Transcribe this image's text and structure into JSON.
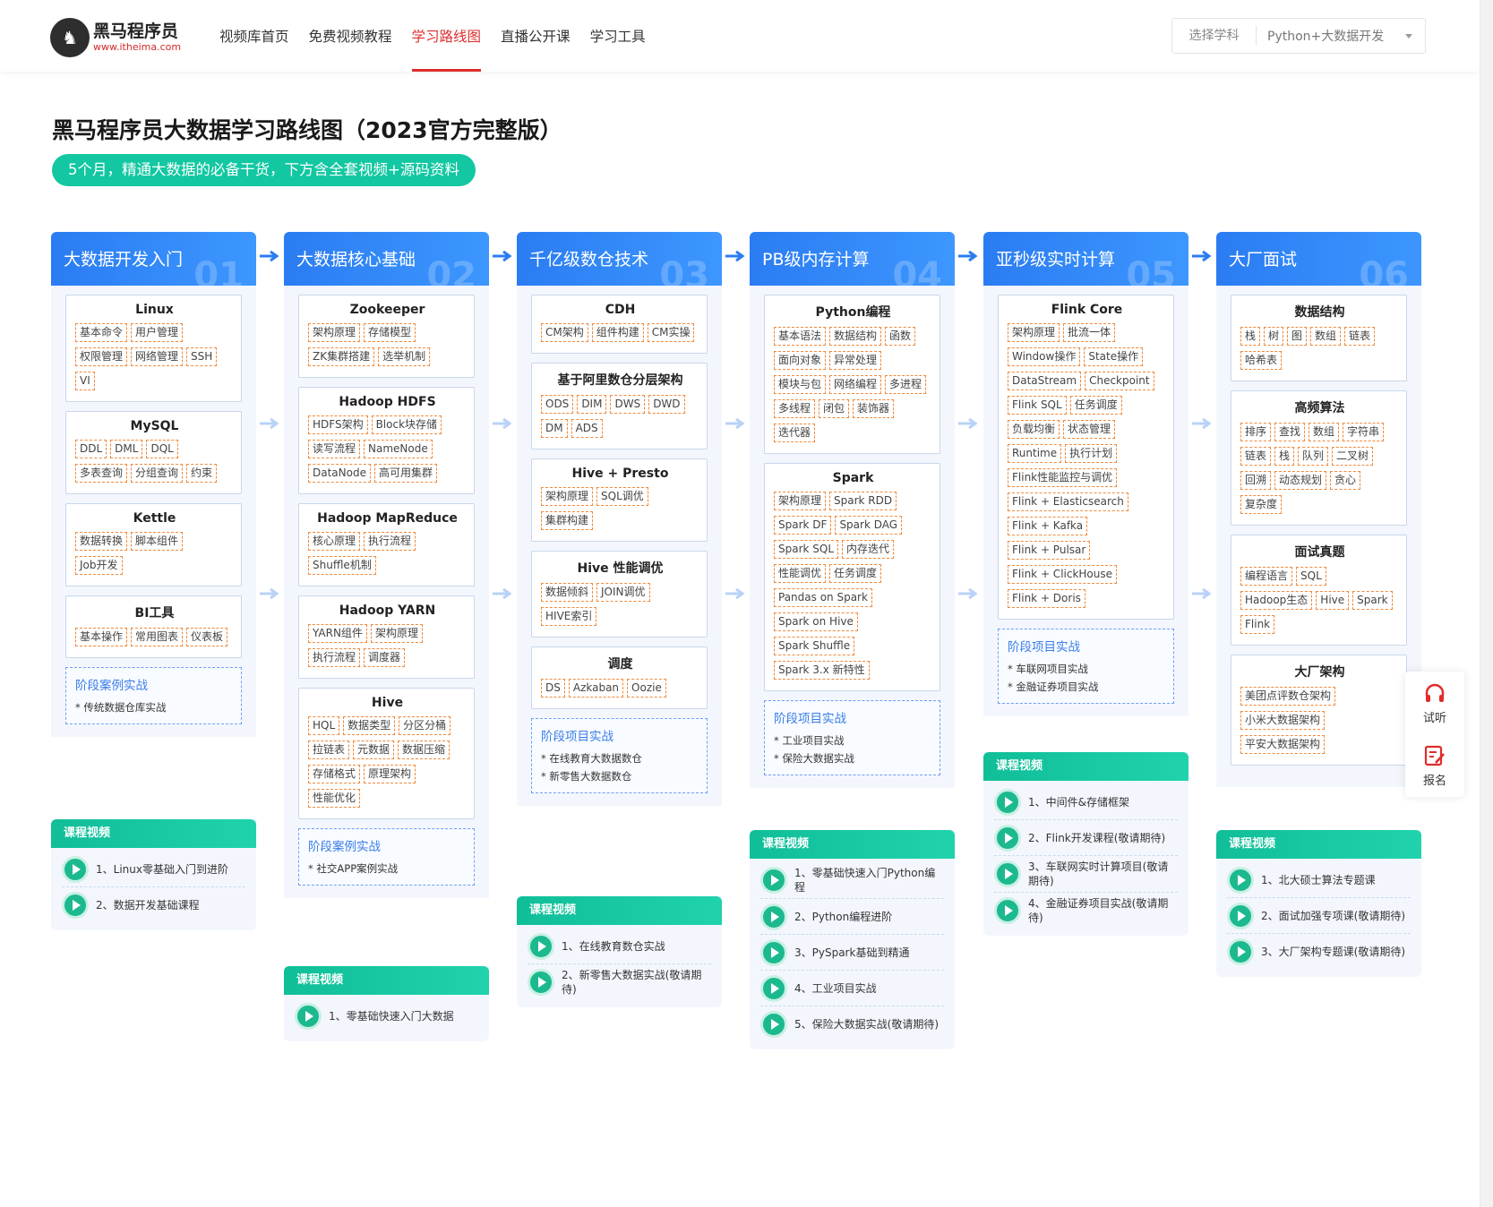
{
  "header": {
    "logo_name": "黑马程序员",
    "logo_url": "www.itheima.com",
    "nav": [
      "视频库首页",
      "免费视频教程",
      "学习路线图",
      "直播公开课",
      "学习工具"
    ],
    "active_nav": "学习路线图",
    "selector_label": "选择学科",
    "selector_value": "Python+大数据开发"
  },
  "page_title": "黑马程序员大数据学习路线图（2023官方完整版）",
  "subtitle": "5个月，精通大数据的必备干货，下方含全套视频+源码资料",
  "columns": [
    {
      "title": "大数据开发入门",
      "num": "01",
      "cards": [
        {
          "title": "Linux",
          "tags": [
            "基本命令",
            "用户管理",
            "权限管理",
            "网络管理",
            "SSH",
            "VI"
          ]
        },
        {
          "title": "MySQL",
          "tags": [
            "DDL",
            "DML",
            "DQL",
            "多表查询",
            "分组查询",
            "约束"
          ]
        },
        {
          "title": "Kettle",
          "tags": [
            "数据转换",
            "脚本组件",
            "Job开发"
          ]
        },
        {
          "title": "BI工具",
          "tags": [
            "基本操作",
            "常用图表",
            "仪表板"
          ]
        }
      ],
      "stage_title": "阶段案例实战",
      "stage_items": [
        "* 传统数据仓库实战"
      ],
      "video_head": "课程视频",
      "videos": [
        "1、Linux零基础入门到进阶",
        "2、数据开发基础课程"
      ]
    },
    {
      "title": "大数据核心基础",
      "num": "02",
      "cards": [
        {
          "title": "Zookeeper",
          "tags": [
            "架构原理",
            "存储模型",
            "ZK集群搭建",
            "选举机制"
          ]
        },
        {
          "title": "Hadoop HDFS",
          "tags": [
            "HDFS架构",
            "Block块存储",
            "读写流程",
            "NameNode",
            "DataNode",
            "高可用集群"
          ]
        },
        {
          "title": "Hadoop MapReduce",
          "tags": [
            "核心原理",
            "执行流程",
            "Shuffle机制"
          ]
        },
        {
          "title": "Hadoop YARN",
          "tags": [
            "YARN组件",
            "架构原理",
            "执行流程",
            "调度器"
          ]
        },
        {
          "title": "Hive",
          "tags": [
            "HQL",
            "数据类型",
            "分区分桶",
            "拉链表",
            "元数据",
            "数据压缩",
            "存储格式",
            "原理架构",
            "性能优化"
          ]
        }
      ],
      "stage_title": "阶段案例实战",
      "stage_items": [
        "* 社交APP案例实战"
      ],
      "video_head": "课程视频",
      "videos": [
        "1、零基础快速入门大数据"
      ]
    },
    {
      "title": "千亿级数仓技术",
      "num": "03",
      "cards": [
        {
          "title": "CDH",
          "tags": [
            "CM架构",
            "组件构建",
            "CM实操"
          ]
        },
        {
          "title": "基于阿里数仓分层架构",
          "tags": [
            "ODS",
            "DIM",
            "DWS",
            "DWD",
            "DM",
            "ADS"
          ]
        },
        {
          "title": "Hive + Presto",
          "tags": [
            "架构原理",
            "SQL调优",
            "集群构建"
          ]
        },
        {
          "title": "Hive 性能调优",
          "tags": [
            "数据倾斜",
            "JOIN调优",
            "HIVE索引"
          ]
        },
        {
          "title": "调度",
          "tags": [
            "DS",
            "Azkaban",
            "Oozie"
          ]
        }
      ],
      "stage_title": "阶段项目实战",
      "stage_items": [
        "* 在线教育大数据数仓",
        "* 新零售大数据数仓"
      ],
      "video_head": "课程视频",
      "videos": [
        "1、在线教育数仓实战",
        "2、新零售大数据实战(敬请期待)"
      ]
    },
    {
      "title": "PB级内存计算",
      "num": "04",
      "cards": [
        {
          "title": "Python编程",
          "tags": [
            "基本语法",
            "数据结构",
            "函数",
            "面向对象",
            "异常处理",
            "模块与包",
            "网络编程",
            "多进程",
            "多线程",
            "闭包",
            "装饰器",
            "迭代器"
          ]
        },
        {
          "title": "Spark",
          "tags": [
            "架构原理",
            "Spark RDD",
            "Spark DF",
            "Spark DAG",
            "Spark SQL",
            "内存迭代",
            "性能调优",
            "任务调度",
            "Pandas on Spark",
            "Spark on Hive",
            "Spark Shuffle",
            "Spark 3.x 新特性"
          ]
        }
      ],
      "stage_title": "阶段项目实战",
      "stage_items": [
        "* 工业项目实战",
        "* 保险大数据实战"
      ],
      "video_head": "课程视频",
      "videos": [
        "1、零基础快速入门Python编程",
        "2、Python编程进阶",
        "3、PySpark基础到精通",
        "4、工业项目实战",
        "5、保险大数据实战(敬请期待)"
      ]
    },
    {
      "title": "亚秒级实时计算",
      "num": "05",
      "cards": [
        {
          "title": "Flink Core",
          "tags": [
            "架构原理",
            "批流一体",
            "Window操作",
            "State操作",
            "DataStream",
            "Checkpoint",
            "Flink SQL",
            "任务调度",
            "负载均衡",
            "状态管理",
            "Runtime",
            "执行计划",
            "Flink性能监控与调优",
            "Flink + Elasticsearch",
            "Flink + Kafka",
            "Flink + Pulsar",
            "Flink + ClickHouse",
            "Flink + Doris"
          ]
        }
      ],
      "stage_title": "阶段项目实战",
      "stage_items": [
        "* 车联网项目实战",
        "* 金融证券项目实战"
      ],
      "video_head": "课程视频",
      "videos": [
        "1、中间件&存储框架",
        "2、Flink开发课程(敬请期待)",
        "3、车联网实时计算项目(敬请期待)",
        "4、金融证券项目实战(敬请期待)"
      ]
    },
    {
      "title": "大厂面试",
      "num": "06",
      "cards": [
        {
          "title": "数据结构",
          "tags": [
            "栈",
            "树",
            "图",
            "数组",
            "链表",
            "哈希表"
          ]
        },
        {
          "title": "高频算法",
          "tags": [
            "排序",
            "查找",
            "数组",
            "字符串",
            "链表",
            "栈",
            "队列",
            "二叉树",
            "回溯",
            "动态规划",
            "贪心",
            "复杂度"
          ]
        },
        {
          "title": "面试真题",
          "tags": [
            "编程语言",
            "SQL",
            "Hadoop生态",
            "Hive",
            "Spark",
            "Flink"
          ]
        },
        {
          "title": "大厂架构",
          "tags": [
            "美团点评数仓架构",
            "小米大数据架构",
            "平安大数据架构"
          ]
        }
      ],
      "stage_title": "",
      "stage_items": [],
      "video_head": "课程视频",
      "videos": [
        "1、北大硕士算法专题课",
        "2、面试加强专项课(敬请期待)",
        "3、大厂架构专题课(敬请期待)"
      ]
    }
  ],
  "side": {
    "listen": "试听",
    "signup": "报名"
  },
  "colors": {
    "primary_blue": "#2b7cf2",
    "green": "#12c7a1",
    "active_red": "#e02c2c",
    "tag_border": "#f08a3c"
  },
  "icons": [
    "logo-horse-icon",
    "caret-down-icon",
    "arrow-right-icon",
    "play-icon",
    "headphone-icon",
    "signup-form-icon"
  ]
}
